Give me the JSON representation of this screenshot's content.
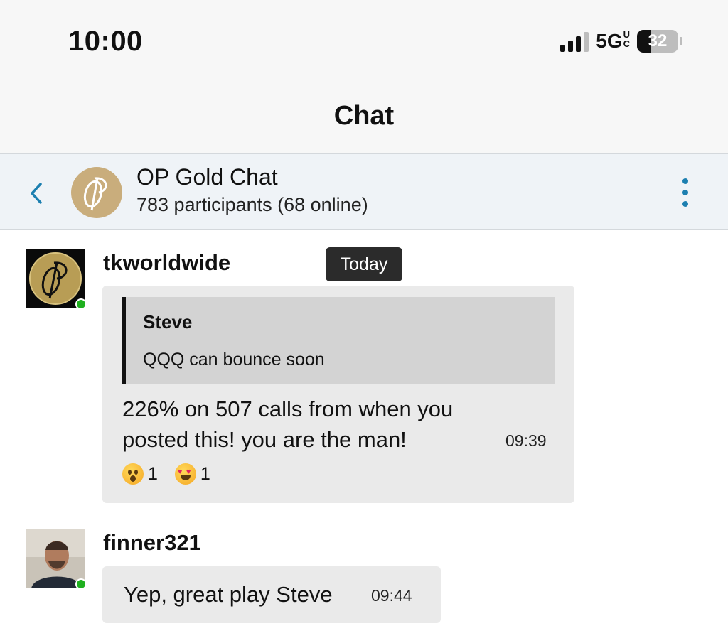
{
  "status_bar": {
    "time": "10:00",
    "network": "5G",
    "network_sub": [
      "U",
      "C"
    ],
    "battery": "32",
    "battery_level": 0.32
  },
  "nav": {
    "title": "Chat"
  },
  "chat_header": {
    "group_name": "OP Gold Chat",
    "participants": "783 participants (68 online)",
    "accent_color": "#1c7fb0"
  },
  "date_pill": "Today",
  "messages": [
    {
      "user": "tkworldwide",
      "online": true,
      "quote": {
        "author": "Steve",
        "text": "QQQ can bounce soon"
      },
      "text_lines": [
        "226% on 507 calls from when you",
        "posted this! you are the man!"
      ],
      "time": "09:39",
      "reactions": [
        {
          "emoji": "astonished-face",
          "count": "1"
        },
        {
          "emoji": "heart-eyes-face",
          "count": "1"
        }
      ]
    },
    {
      "user": "finner321",
      "online": true,
      "text": "Yep, great play Steve",
      "time": "09:44"
    }
  ]
}
